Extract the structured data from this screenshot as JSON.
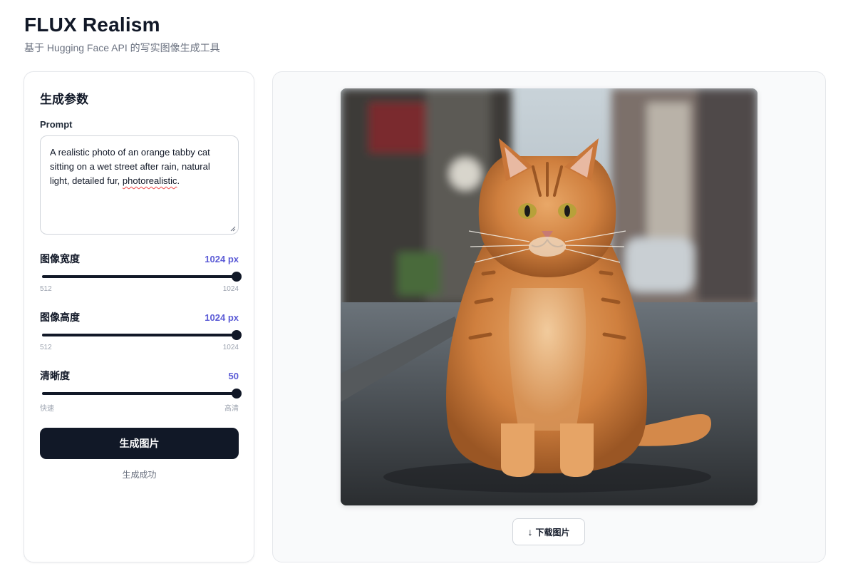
{
  "header": {
    "title": "FLUX Realism",
    "subtitle": "基于 Hugging Face API 的写实图像生成工具"
  },
  "params": {
    "title": "生成参数",
    "prompt_label": "Prompt",
    "prompt_value_before": "A realistic photo of an orange tabby cat sitting on a wet street after rain, natural light, detailed fur, ",
    "prompt_value_misspelled": "photorealistic",
    "prompt_value_after": ".",
    "sliders": [
      {
        "label": "图像宽度",
        "value": 1024,
        "value_text": "1024 px",
        "min": 512,
        "max": 1024,
        "min_label": "512",
        "max_label": "1024"
      },
      {
        "label": "图像高度",
        "value": 1024,
        "value_text": "1024 px",
        "min": 512,
        "max": 1024,
        "min_label": "512",
        "max_label": "1024"
      },
      {
        "label": "清晰度",
        "value": 50,
        "value_text": "50",
        "min": 1,
        "max": 50,
        "min_label": "快速",
        "max_label": "高清"
      }
    ],
    "generate_label": "生成图片",
    "status": "生成成功"
  },
  "result": {
    "image_alt": "Photorealistic orange tabby cat sitting on a wet city street",
    "download_arrow": "↓",
    "download_label": "下载图片"
  },
  "colors": {
    "accent": "#5b5bd6",
    "primary_button": "#111827"
  }
}
